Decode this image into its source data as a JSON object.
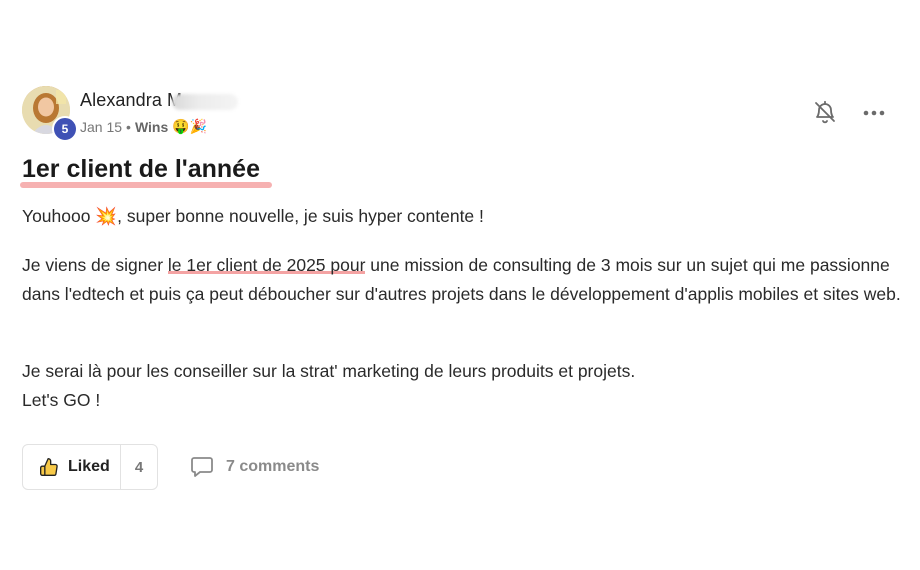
{
  "post": {
    "author": {
      "name": "Alexandra M",
      "level": "5"
    },
    "meta": {
      "date": "Jan 15",
      "separator": "•",
      "space": "Wins",
      "space_emojis": "🤑🎉"
    },
    "title": "1er client de l'année",
    "body": {
      "p1_text": "Youhooo ",
      "p1_emoji": "💥",
      "p1_rest": ", super bonne nouvelle, je suis hyper contente !",
      "p2_before": "Je viens de signer ",
      "p2_highlight": "le 1er client de 2025 pour",
      "p2_after": " une mission de consulting de 3 mois sur un sujet qui me passionne dans l'edtech et puis ça peut déboucher sur d'autres projets dans le développement d'applis mobiles et sites web.",
      "p3_line1": "Je serai là pour les conseiller sur la strat' marketing de leurs produits et projets.",
      "p3_line2": "Let's GO !"
    },
    "actions": {
      "like_label": "Liked",
      "like_count": "4",
      "comments_label": "7 comments"
    },
    "icons": {
      "bell": "bell-off-icon",
      "more": "more-horizontal-icon",
      "like": "thumbs-up-icon",
      "comment": "comment-icon"
    },
    "colors": {
      "highlight_underline": "#f4a3a3",
      "level_badge": "#3f51b5"
    }
  }
}
